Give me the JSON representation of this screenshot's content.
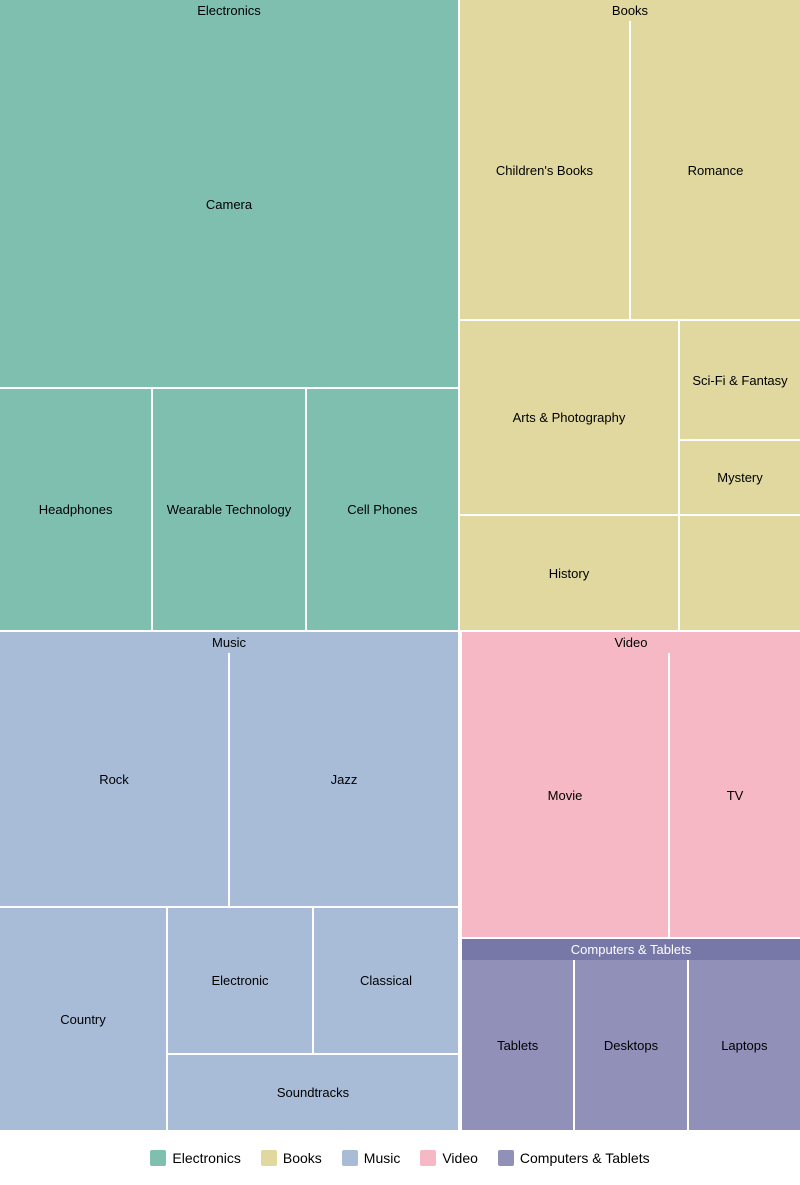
{
  "categories": {
    "electronics": {
      "label": "Electronics",
      "color": "#7fbfb0",
      "items": {
        "camera": "Camera",
        "headphones": "Headphones",
        "wearable": "Wearable Technology",
        "cellphones": "Cell Phones"
      }
    },
    "books": {
      "label": "Books",
      "color": "#e0d89e",
      "items": {
        "childrens": "Children's Books",
        "romance": "Romance",
        "arts": "Arts & Photography",
        "scifi": "Sci-Fi & Fantasy",
        "history": "History",
        "mystery": "Mystery"
      }
    },
    "music": {
      "label": "Music",
      "color": "#a8bcd8",
      "items": {
        "rock": "Rock",
        "jazz": "Jazz",
        "country": "Country",
        "electronic": "Electronic",
        "classical": "Classical",
        "soundtracks": "Soundtracks"
      }
    },
    "video": {
      "label": "Video",
      "color": "#f5b8c4",
      "items": {
        "movie": "Movie",
        "tv": "TV"
      }
    },
    "computers": {
      "label": "Computers & Tablets",
      "color": "#9090b8",
      "header_color": "#7878a8",
      "items": {
        "tablets": "Tablets",
        "desktops": "Desktops",
        "laptops": "Laptops"
      }
    }
  },
  "legend": {
    "items": [
      {
        "label": "Electronics",
        "color": "#7fbfb0"
      },
      {
        "label": "Books",
        "color": "#e0d89e"
      },
      {
        "label": "Music",
        "color": "#a8bcd8"
      },
      {
        "label": "Video",
        "color": "#f5b8c4"
      },
      {
        "label": "Computers & Tablets",
        "color": "#9090b8"
      }
    ]
  }
}
